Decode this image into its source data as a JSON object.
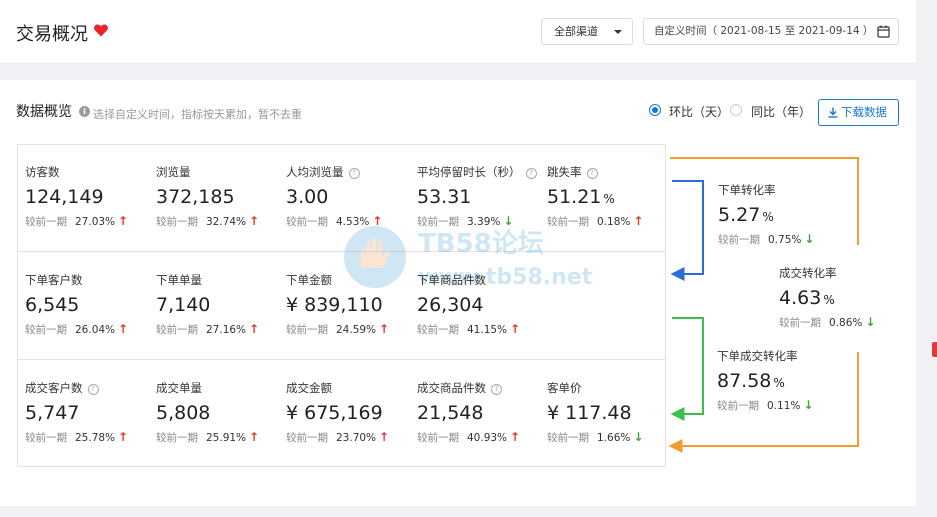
{
  "header": {
    "title": "交易概况",
    "channel_select": "全部渠道",
    "date_range": "自定义时间（ 2021-08-15 至 2021-09-14 ）"
  },
  "overview": {
    "title": "数据概览",
    "hint": "选择自定义时间，指标按天累加，暂不去重",
    "radio_day": "环比（天）",
    "radio_year": "同比（年）",
    "download": "下载数据",
    "compare_label": "较前一期"
  },
  "metrics": [
    {
      "label": "访客数",
      "help": false,
      "value": "124,149",
      "unit": "",
      "change": "27.03%",
      "trend": "up"
    },
    {
      "label": "浏览量",
      "help": false,
      "value": "372,185",
      "unit": "",
      "change": "32.74%",
      "trend": "up"
    },
    {
      "label": "人均浏览量",
      "help": true,
      "value": "3.00",
      "unit": "",
      "change": "4.53%",
      "trend": "up"
    },
    {
      "label": "平均停留时长（秒）",
      "help": true,
      "value": "53.31",
      "unit": "",
      "change": "3.39%",
      "trend": "down"
    },
    {
      "label": "跳失率",
      "help": true,
      "value": "51.21",
      "unit": "%",
      "change": "0.18%",
      "trend": "up"
    },
    {
      "label": "下单客户数",
      "help": false,
      "value": "6,545",
      "unit": "",
      "change": "26.04%",
      "trend": "up"
    },
    {
      "label": "下单单量",
      "help": false,
      "value": "7,140",
      "unit": "",
      "change": "27.16%",
      "trend": "up"
    },
    {
      "label": "下单金额",
      "help": false,
      "value": "¥ 839,110",
      "unit": "",
      "change": "24.59%",
      "trend": "up"
    },
    {
      "label": "下单商品件数",
      "help": false,
      "value": "26,304",
      "unit": "",
      "change": "41.15%",
      "trend": "up"
    },
    {
      "label": "成交客户数",
      "help": true,
      "value": "5,747",
      "unit": "",
      "change": "25.78%",
      "trend": "up"
    },
    {
      "label": "成交单量",
      "help": false,
      "value": "5,808",
      "unit": "",
      "change": "25.91%",
      "trend": "up"
    },
    {
      "label": "成交金额",
      "help": false,
      "value": "¥ 675,169",
      "unit": "",
      "change": "23.70%",
      "trend": "up"
    },
    {
      "label": "成交商品件数",
      "help": true,
      "value": "21,548",
      "unit": "",
      "change": "40.93%",
      "trend": "up"
    },
    {
      "label": "客单价",
      "help": false,
      "value": "¥ 117.48",
      "unit": "",
      "change": "1.66%",
      "trend": "down"
    }
  ],
  "conversions": [
    {
      "label": "下单转化率",
      "value": "5.27",
      "unit": "%",
      "change": "0.75%",
      "trend": "down"
    },
    {
      "label": "成交转化率",
      "value": "4.63",
      "unit": "%",
      "change": "0.86%",
      "trend": "down"
    },
    {
      "label": "下单成交转化率",
      "value": "87.58",
      "unit": "%",
      "change": "0.11%",
      "trend": "down"
    }
  ],
  "watermark": {
    "title": "TB58论坛",
    "url": "www.tb58.net"
  },
  "colors": {
    "accent": "#1976d2",
    "up": "#e53935",
    "down": "#43a047",
    "flow_orange": "#f39c34",
    "flow_green": "#3cc04b",
    "flow_blue": "#2f6bd6",
    "heart": "#e8262a"
  },
  "icons": [
    "heart-icon",
    "chevron-down-icon",
    "calendar-icon",
    "info-icon",
    "download-icon",
    "help-icon",
    "arrow-up-icon",
    "arrow-down-icon"
  ]
}
